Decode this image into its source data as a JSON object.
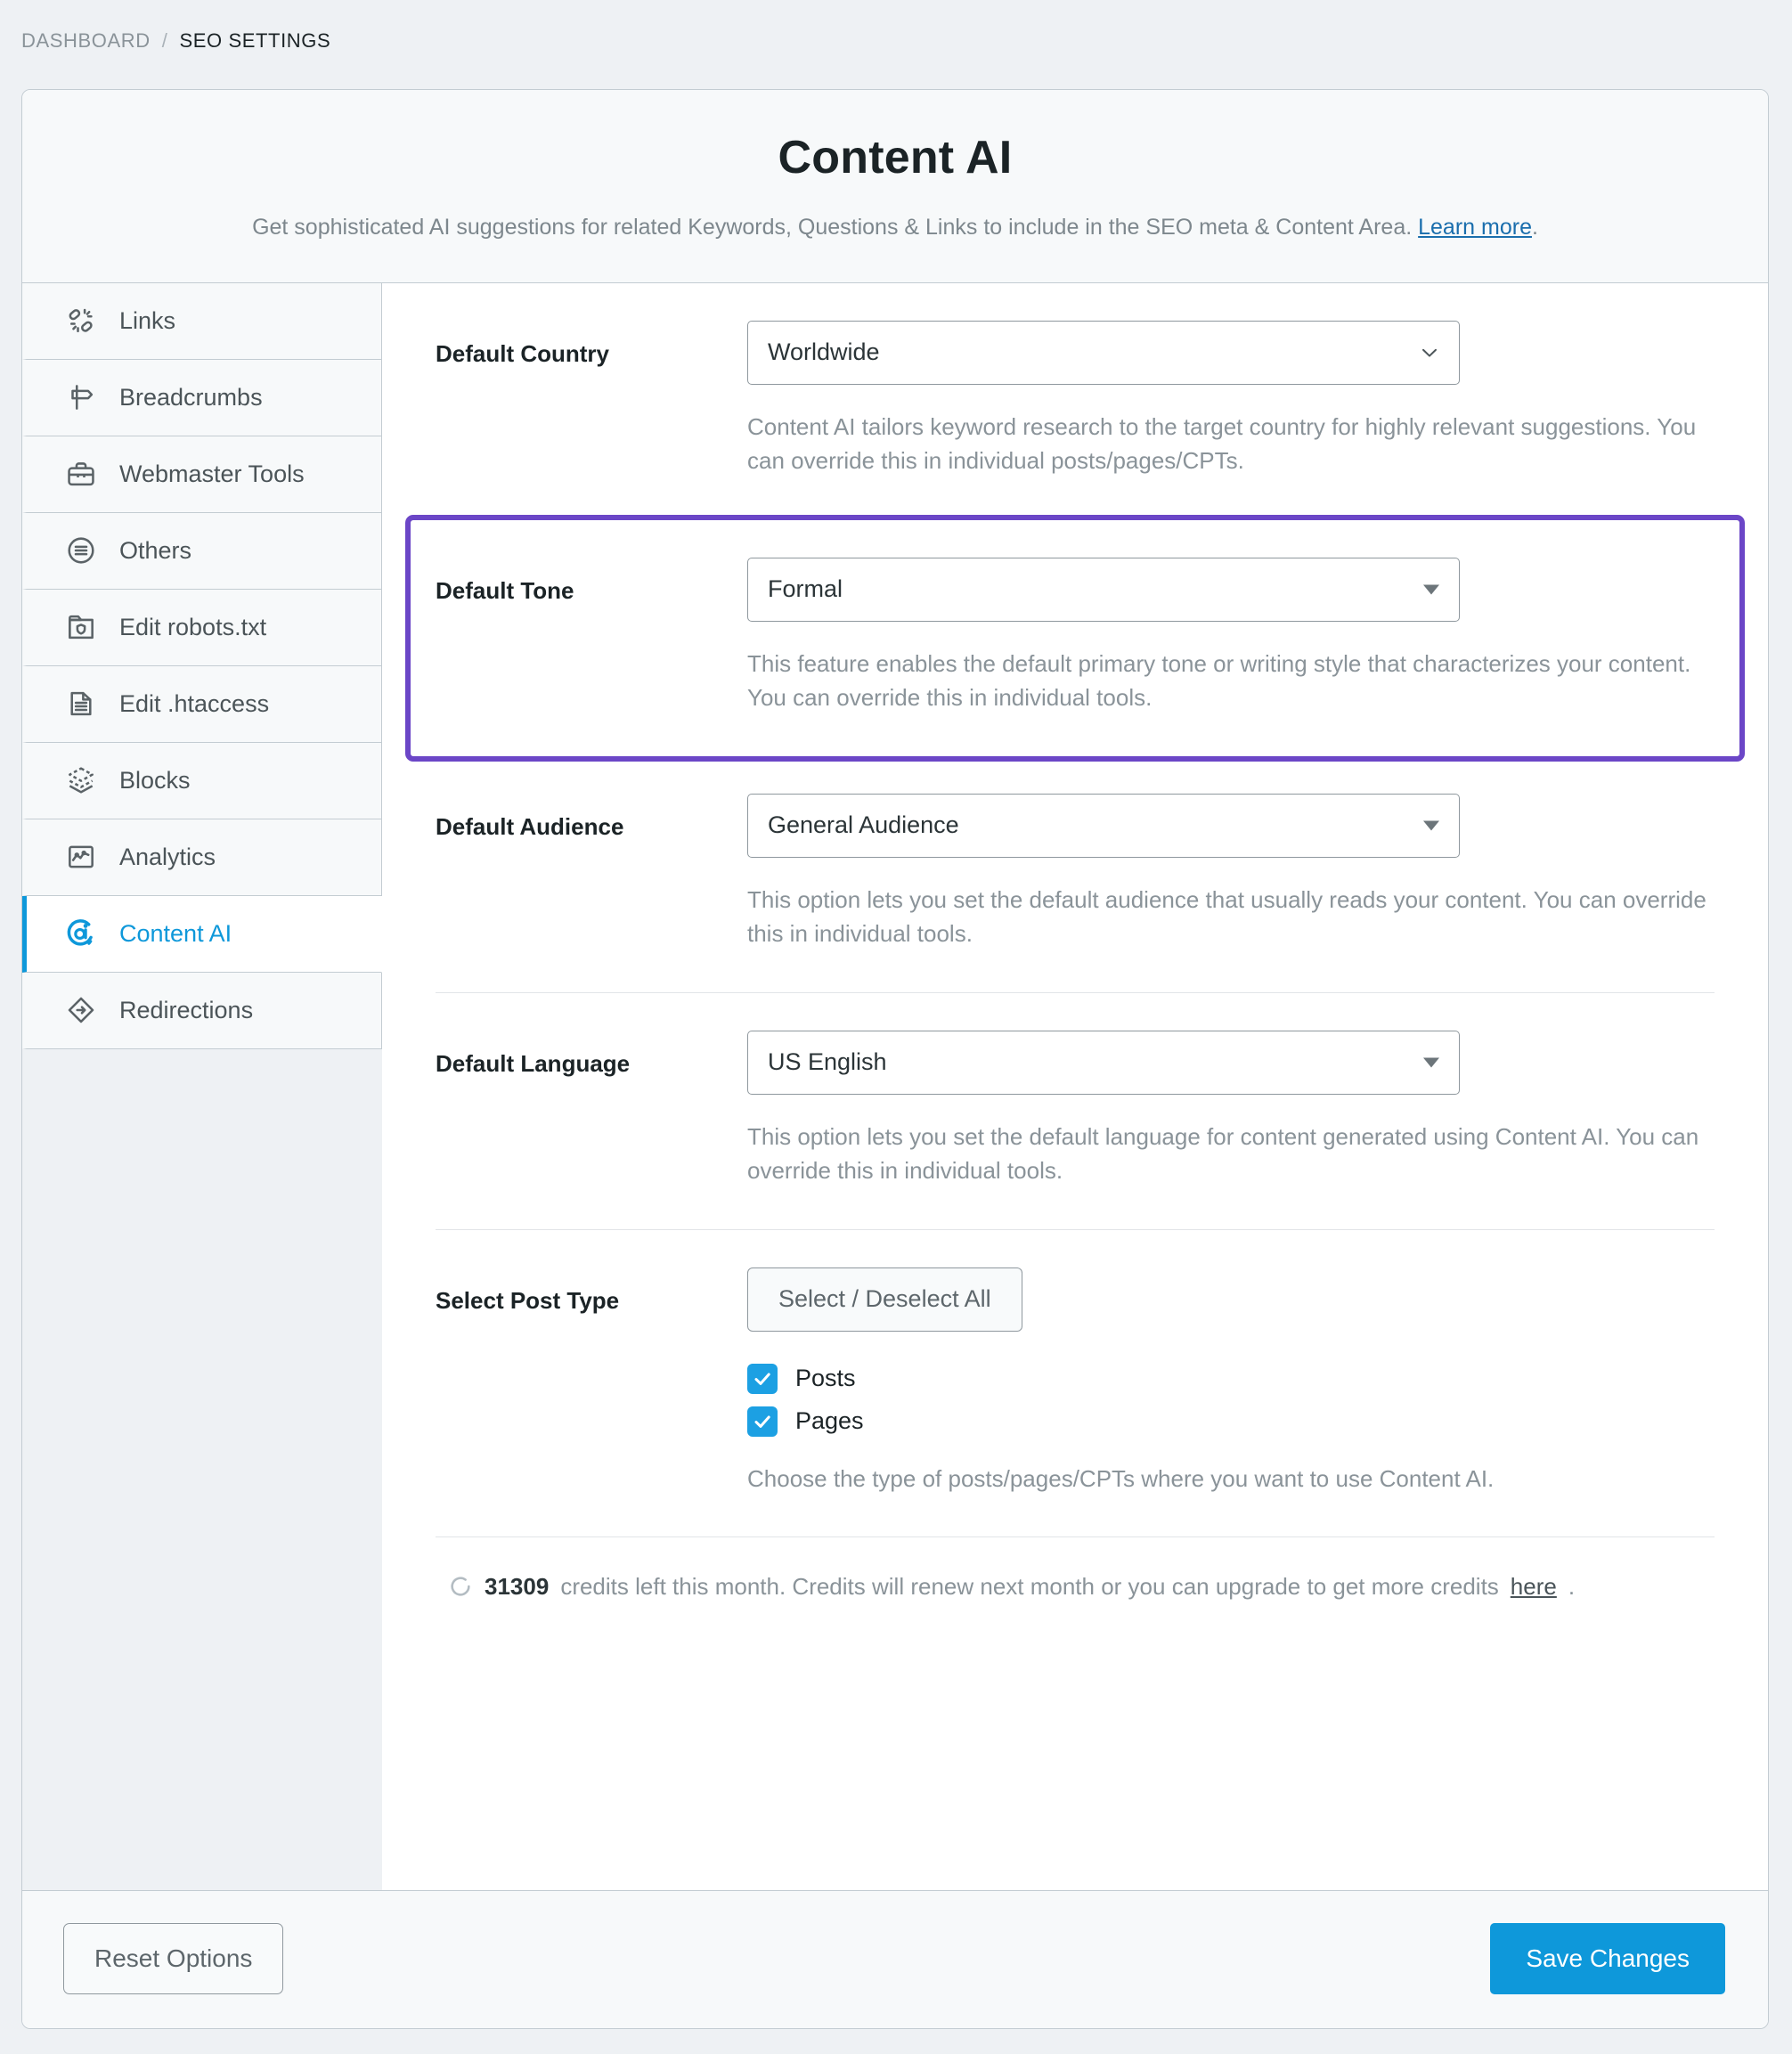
{
  "breadcrumb": {
    "root": "DASHBOARD",
    "separator": "/",
    "current": "SEO SETTINGS"
  },
  "header": {
    "title": "Content AI",
    "description_before": "Get sophisticated AI suggestions for related Keywords, Questions & Links to include in the SEO meta & Content Area.",
    "learn_more": "Learn more",
    "description_after": "."
  },
  "sidebar": {
    "items": [
      {
        "label": "Links",
        "icon": "links-icon",
        "active": false
      },
      {
        "label": "Breadcrumbs",
        "icon": "signpost-icon",
        "active": false
      },
      {
        "label": "Webmaster Tools",
        "icon": "briefcase-icon",
        "active": false
      },
      {
        "label": "Others",
        "icon": "circle-list-icon",
        "active": false
      },
      {
        "label": "Edit robots.txt",
        "icon": "folder-shield-icon",
        "active": false
      },
      {
        "label": "Edit .htaccess",
        "icon": "file-lines-icon",
        "active": false
      },
      {
        "label": "Blocks",
        "icon": "layers-icon",
        "active": false
      },
      {
        "label": "Analytics",
        "icon": "analytics-chart-icon",
        "active": false
      },
      {
        "label": "Content AI",
        "icon": "content-ai-icon",
        "active": true
      },
      {
        "label": "Redirections",
        "icon": "redirect-diamond-icon",
        "active": false
      }
    ]
  },
  "form": {
    "country": {
      "label": "Default Country",
      "value": "Worldwide",
      "help": "Content AI tailors keyword research to the target country for highly relevant suggestions. You can override this in individual posts/pages/CPTs."
    },
    "tone": {
      "label": "Default Tone",
      "value": "Formal",
      "help": "This feature enables the default primary tone or writing style that characterizes your content. You can override this in individual tools.",
      "highlighted": true,
      "highlight_color": "#6b46c7"
    },
    "audience": {
      "label": "Default Audience",
      "value": "General Audience",
      "help": "This option lets you set the default audience that usually reads your content. You can override this in individual tools."
    },
    "language": {
      "label": "Default Language",
      "value": "US English",
      "help": "This option lets you set the default language for content generated using Content AI. You can override this in individual tools."
    },
    "post_type": {
      "label": "Select Post Type",
      "select_all_button": "Select / Deselect All",
      "options": [
        {
          "label": "Posts",
          "checked": true
        },
        {
          "label": "Pages",
          "checked": true
        }
      ],
      "help": "Choose the type of posts/pages/CPTs where you want to use Content AI."
    }
  },
  "credits": {
    "icon": "credits-refresh-icon",
    "amount": "31309",
    "text_before": "credits left this month. Credits will renew next month or you can upgrade to get more credits",
    "link": "here",
    "text_after": "."
  },
  "footer": {
    "reset_label": "Reset Options",
    "save_label": "Save Changes"
  },
  "colors": {
    "accent_blue": "#0e98da",
    "checkbox_blue": "#1ca0e3",
    "highlight_purple": "#6b46c7",
    "page_background": "#eef1f4",
    "panel_background": "#f7f9fa"
  }
}
